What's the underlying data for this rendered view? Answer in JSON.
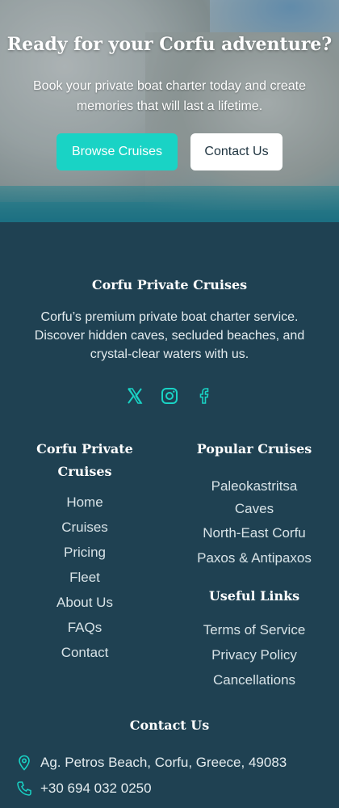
{
  "hero": {
    "title": "Ready for your Corfu adventure?",
    "subtitle": "Book your private boat charter today and create memories that will last a lifetime.",
    "primary_button": "Browse Cruises",
    "secondary_button": "Contact Us"
  },
  "footer": {
    "brand": "Corfu Private Cruises",
    "description": "Corfu’s premium private boat charter service. Discover hidden caves, secluded beaches, and crystal-clear waters with us.",
    "social": [
      {
        "icon": "x-twitter-icon"
      },
      {
        "icon": "instagram-icon"
      },
      {
        "icon": "facebook-icon"
      }
    ],
    "nav_column": {
      "title": "Corfu Private Cruises",
      "links": [
        "Home",
        "Cruises",
        "Pricing",
        "Fleet",
        "About Us",
        "FAQs",
        "Contact"
      ]
    },
    "popular": {
      "title": "Popular Cruises",
      "links": [
        "Paleokastritsa Caves",
        "North-East Corfu",
        "Paxos & Antipaxos"
      ]
    },
    "useful": {
      "title": "Useful Links",
      "links": [
        "Terms of Service",
        "Privacy Policy",
        "Cancellations"
      ]
    },
    "contact": {
      "title": "Contact Us",
      "address": "Ag. Petros Beach, Corfu, Greece, 49083",
      "phone": "+30 694 032 0250"
    }
  },
  "colors": {
    "accent": "#19d3c5",
    "footer_bg": "#1f4152"
  }
}
